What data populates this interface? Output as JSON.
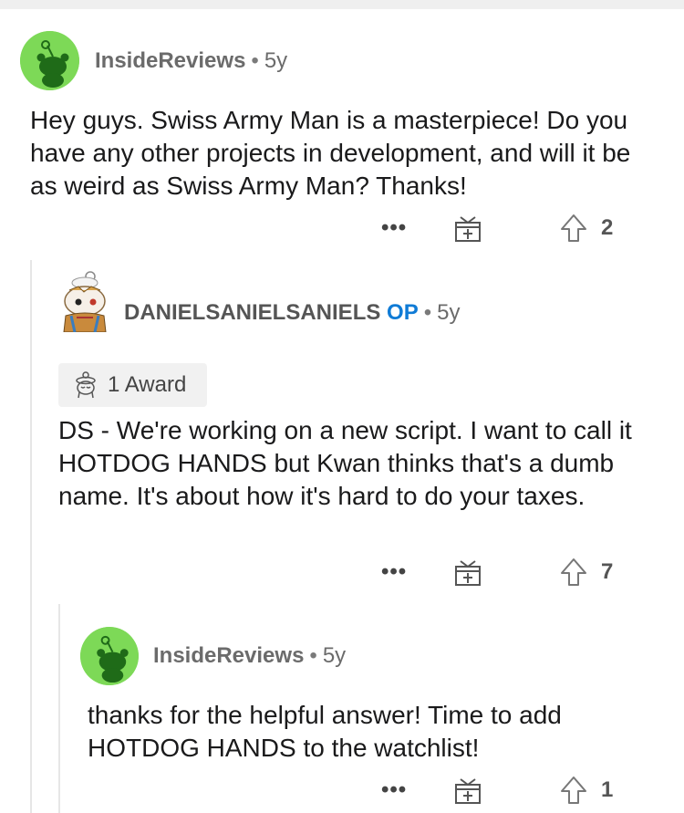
{
  "comments": [
    {
      "author": "InsideReviews",
      "separator": "•",
      "age": "5y",
      "body": "Hey guys. Swiss Army Man is a masterpiece! Do you have any other projects in development, and will it be as weird as Swiss Army Man? Thanks!",
      "more": "•••",
      "score": "2",
      "avatar_color": "#7dd957"
    },
    {
      "author": "DANIELSANIELSANIELS",
      "op_badge": "OP",
      "separator": "•",
      "age": "5y",
      "award": "1 Award",
      "body": "DS - We're working on a new script.  I want to call it HOTDOG HANDS but Kwan thinks that's a dumb name.  It's about how it's hard to do your taxes.",
      "more": "•••",
      "score": "7"
    },
    {
      "author": "InsideReviews",
      "separator": "•",
      "age": "5y",
      "body": "thanks for the helpful answer! Time to add HOTDOG HANDS to the watchlist!",
      "more": "•••",
      "score": "1",
      "avatar_color": "#7dd957"
    }
  ],
  "icons": {
    "gift": "gift-icon",
    "upvote": "upvote-arrow-icon",
    "award": "award-icon",
    "avatar": "snoo-avatar-icon"
  },
  "colors": {
    "op_badge": "#0f7bd6",
    "avatar_green": "#7dd957",
    "thread_line": "#e6e6e6"
  }
}
